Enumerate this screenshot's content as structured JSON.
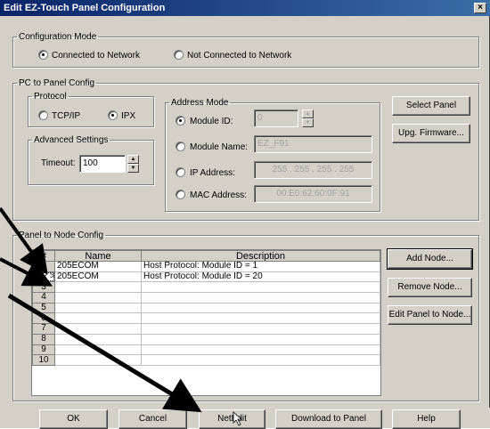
{
  "window": {
    "title": "Edit EZ-Touch Panel Configuration",
    "close": "×"
  },
  "config_mode": {
    "legend": "Configuration Mode",
    "connected": "Connected to Network",
    "not_connected": "Not Connected to Network",
    "selected": "connected"
  },
  "pc_panel": {
    "legend": "PC to Panel Config",
    "protocol": {
      "legend": "Protocol",
      "tcpip": "TCP/IP",
      "ipx": "IPX",
      "selected": "ipx"
    },
    "advanced": {
      "legend": "Advanced Settings",
      "timeout_label": "Timeout:",
      "timeout_value": "100"
    },
    "address": {
      "legend": "Address Mode",
      "module_id_label": "Module ID:",
      "module_id_value": "0",
      "module_name_label": "Module Name:",
      "module_name_value": "EZ_F91",
      "ip_label": "IP Address:",
      "ip_value": "255 . 255 . 255 . 255",
      "mac_label": "MAC Address:",
      "mac_value": "00:E0:62:60:0F:91",
      "selected": "module_id"
    },
    "select_panel": "Select Panel",
    "upg_firmware": "Upg. Firmware..."
  },
  "node_config": {
    "legend": "Panel to Node Config",
    "columns": [
      "#",
      "Name",
      "Description"
    ],
    "rows": [
      {
        "num": "1",
        "name": "205ECOM",
        "desc": "Host Protocol: Module ID = 1"
      },
      {
        "num": "< 2 >",
        "name": "205ECOM",
        "desc": "Host Protocol: Module ID = 20"
      },
      {
        "num": "3",
        "name": "",
        "desc": ""
      },
      {
        "num": "4",
        "name": "",
        "desc": ""
      },
      {
        "num": "5",
        "name": "",
        "desc": ""
      },
      {
        "num": "6",
        "name": "",
        "desc": ""
      },
      {
        "num": "7",
        "name": "",
        "desc": ""
      },
      {
        "num": "8",
        "name": "",
        "desc": ""
      },
      {
        "num": "9",
        "name": "",
        "desc": ""
      },
      {
        "num": "10",
        "name": "",
        "desc": ""
      }
    ],
    "add_node": "Add Node...",
    "remove_node": "Remove Node...",
    "edit_panel_to_node": "Edit Panel to Node..."
  },
  "footer": {
    "ok": "OK",
    "cancel": "Cancel",
    "netedit": "NetEdit",
    "download": "Download to Panel",
    "help": "Help"
  }
}
